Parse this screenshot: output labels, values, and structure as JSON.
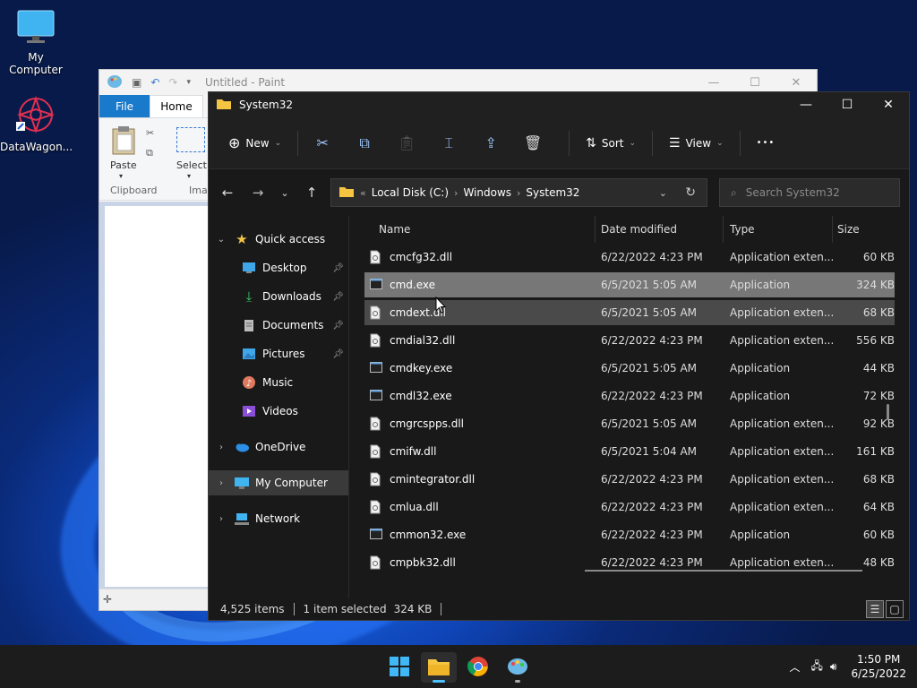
{
  "desktop": {
    "icons": [
      {
        "label": "My Computer"
      },
      {
        "label": "DataWagon..."
      }
    ]
  },
  "paint": {
    "title": "Untitled - Paint",
    "tabs": {
      "file": "File",
      "home": "Home"
    },
    "ribbon": {
      "paste": "Paste",
      "select": "Select",
      "clipboard_group": "Clipboard",
      "image_group_partial": "Imag"
    }
  },
  "explorer": {
    "title": "System32",
    "toolbar": {
      "new": "New",
      "sort": "Sort",
      "view": "View",
      "more": "•••"
    },
    "address": {
      "overflow": "«",
      "segments": [
        "Local Disk (C:)",
        "Windows",
        "System32"
      ]
    },
    "search": {
      "placeholder": "Search System32"
    },
    "sidebar": {
      "quick_access": "Quick access",
      "desktop": "Desktop",
      "downloads": "Downloads",
      "documents": "Documents",
      "pictures": "Pictures",
      "music": "Music",
      "videos": "Videos",
      "onedrive": "OneDrive",
      "my_computer": "My Computer",
      "network": "Network"
    },
    "columns": {
      "name": "Name",
      "date": "Date modified",
      "type": "Type",
      "size": "Size"
    },
    "files": [
      {
        "name": "cmcfg32.dll",
        "date": "6/22/2022 4:23 PM",
        "type": "Application exten...",
        "size": "60 KB"
      },
      {
        "name": "cmd.exe",
        "date": "6/5/2021 5:05 AM",
        "type": "Application",
        "size": "324 KB"
      },
      {
        "name": "cmdext.dll",
        "date": "6/5/2021 5:05 AM",
        "type": "Application exten...",
        "size": "68 KB"
      },
      {
        "name": "cmdial32.dll",
        "date": "6/22/2022 4:23 PM",
        "type": "Application exten...",
        "size": "556 KB"
      },
      {
        "name": "cmdkey.exe",
        "date": "6/5/2021 5:05 AM",
        "type": "Application",
        "size": "44 KB"
      },
      {
        "name": "cmdl32.exe",
        "date": "6/22/2022 4:23 PM",
        "type": "Application",
        "size": "72 KB"
      },
      {
        "name": "cmgrcspps.dll",
        "date": "6/5/2021 5:05 AM",
        "type": "Application exten...",
        "size": "92 KB"
      },
      {
        "name": "cmifw.dll",
        "date": "6/5/2021 5:04 AM",
        "type": "Application exten...",
        "size": "161 KB"
      },
      {
        "name": "cmintegrator.dll",
        "date": "6/22/2022 4:23 PM",
        "type": "Application exten...",
        "size": "68 KB"
      },
      {
        "name": "cmlua.dll",
        "date": "6/22/2022 4:23 PM",
        "type": "Application exten...",
        "size": "64 KB"
      },
      {
        "name": "cmmon32.exe",
        "date": "6/22/2022 4:23 PM",
        "type": "Application",
        "size": "60 KB"
      },
      {
        "name": "cmpbk32.dll",
        "date": "6/22/2022 4:23 PM",
        "type": "Application exten...",
        "size": "48 KB"
      }
    ],
    "status": {
      "count": "4,525 items",
      "selected": "1 item selected",
      "size": "324 KB"
    }
  },
  "taskbar": {
    "time": "1:50 PM",
    "date": "6/25/2022"
  },
  "colors": {
    "accent": "#4cc2ff",
    "folder": "#f5c542",
    "select_row": "#777777"
  }
}
